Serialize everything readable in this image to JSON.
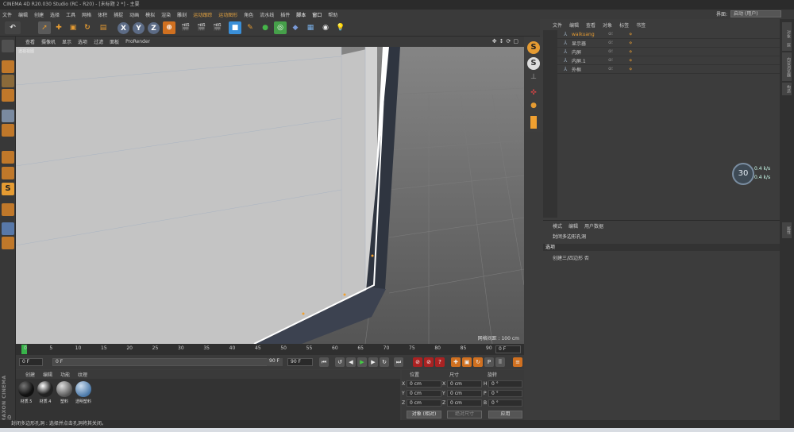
{
  "title": "CINEMA 4D R20.030 Studio (RC - R20) - [未标题 2 *] - 主要",
  "menu": [
    "文件",
    "编辑",
    "创建",
    "选择",
    "工具",
    "网格",
    "体积",
    "捕捉",
    "动画",
    "模拟",
    "渲染",
    "雕刻",
    "运动跟踪",
    "运动图形",
    "角色",
    "流水线",
    "插件",
    "脚本",
    "窗口",
    "帮助"
  ],
  "layout_label": "界面:",
  "layout_value": "启动 (用户)",
  "toolbar_xyz": [
    "X",
    "Y",
    "Z"
  ],
  "viewport": {
    "menu": [
      "查看",
      "摄像机",
      "显示",
      "选项",
      "过滤",
      "面板",
      "ProRender"
    ],
    "label": "透视视图",
    "scale": "网格间距 : 100 cm"
  },
  "timeline": {
    "ticks": [
      "0",
      "5",
      "10",
      "15",
      "20",
      "25",
      "30",
      "35",
      "40",
      "45",
      "50",
      "55",
      "60",
      "65",
      "70",
      "75",
      "80",
      "85",
      "90"
    ],
    "current_frame": "0 F"
  },
  "playbar": {
    "start": "0 F",
    "start2": "0 F",
    "end": "90 F",
    "end2": "90 F"
  },
  "materials": {
    "menu": [
      "创建",
      "编辑",
      "功能",
      "纹理"
    ],
    "items": [
      {
        "name": "材质.5",
        "color": "#1a1a1a"
      },
      {
        "name": "材质.4",
        "color": "#2a2a2a"
      },
      {
        "name": "塑料",
        "color": "#8a8a8a"
      },
      {
        "name": "透明塑料",
        "color": "#6a9ac8"
      }
    ]
  },
  "coords": {
    "headers": [
      "位置",
      "尺寸",
      "旋转"
    ],
    "pos": [
      {
        "l": "X",
        "v": "0 cm"
      },
      {
        "l": "Y",
        "v": "0 cm"
      },
      {
        "l": "Z",
        "v": "0 cm"
      }
    ],
    "size": [
      {
        "l": "X",
        "v": "0 cm"
      },
      {
        "l": "Y",
        "v": "0 cm"
      },
      {
        "l": "Z",
        "v": "0 cm"
      }
    ],
    "rot": [
      {
        "l": "H",
        "v": "0 °"
      },
      {
        "l": "P",
        "v": "0 °"
      },
      {
        "l": "B",
        "v": "0 °"
      }
    ],
    "mode": "对象 (相对)",
    "mode2": "绝对尺寸",
    "apply": "应用"
  },
  "objects": {
    "menu": [
      "文件",
      "编辑",
      "查看",
      "对象",
      "标签",
      "书签"
    ],
    "items": [
      {
        "name": "waikuang",
        "icon": "null-icon"
      },
      {
        "name": "显示器",
        "icon": "null-icon"
      },
      {
        "name": "内屏",
        "icon": "null-icon"
      },
      {
        "name": "内屏.1",
        "icon": "null-icon"
      },
      {
        "name": "外框",
        "icon": "null-icon"
      }
    ]
  },
  "attributes": {
    "menu": [
      "模式",
      "编辑",
      "用户数据"
    ],
    "title": "封闭多边形孔洞",
    "section": "选项",
    "option": "创建三/四边形 否"
  },
  "hud": {
    "fps": "30",
    "s1": "0.4",
    "s2": "0.4",
    "unit": "k/s"
  },
  "status": "封闭多边形孔洞 : 选择并点击孔洞将其关闭。",
  "right_tabs": [
    "对象",
    "层",
    "内容浏览器",
    "构造",
    "属性"
  ],
  "maxon": "MAXON CINEMA 4D"
}
